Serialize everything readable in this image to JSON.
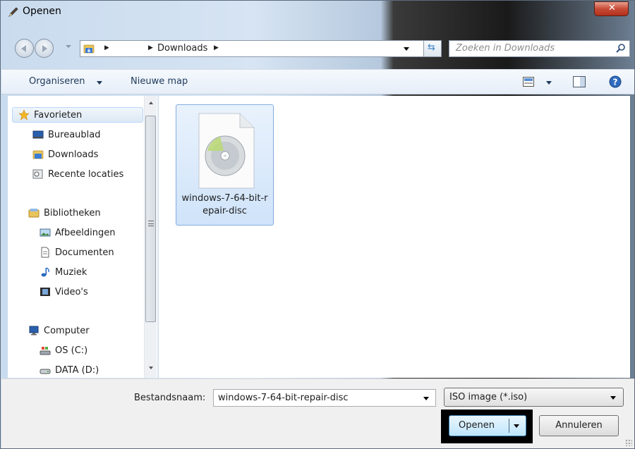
{
  "window": {
    "title": "Openen"
  },
  "address": {
    "crumb": "Downloads",
    "search_placeholder": "Zoeken in Downloads"
  },
  "toolbar": {
    "organize": "Organiseren",
    "new_folder": "Nieuwe map"
  },
  "nav": {
    "favorites": "Favorieten",
    "desktop": "Bureaublad",
    "downloads": "Downloads",
    "recent": "Recente locaties",
    "libraries": "Bibliotheken",
    "pictures": "Afbeeldingen",
    "documents": "Documenten",
    "music": "Muziek",
    "videos": "Video's",
    "computer": "Computer",
    "drive_c": "OS (C:)",
    "drive_d": "DATA (D:)"
  },
  "files": [
    {
      "name": "windows-7-64-bit-repair-disc"
    }
  ],
  "footer": {
    "filename_label": "Bestandsnaam:",
    "filename_value": "windows-7-64-bit-repair-disc",
    "filetype_value": "ISO image (*.iso)",
    "open_label": "Openen",
    "cancel_label": "Annuleren"
  },
  "colors": {
    "selection": "#cfe3fa",
    "selection_border": "#84acdd",
    "highlight_frame": "#000000"
  }
}
